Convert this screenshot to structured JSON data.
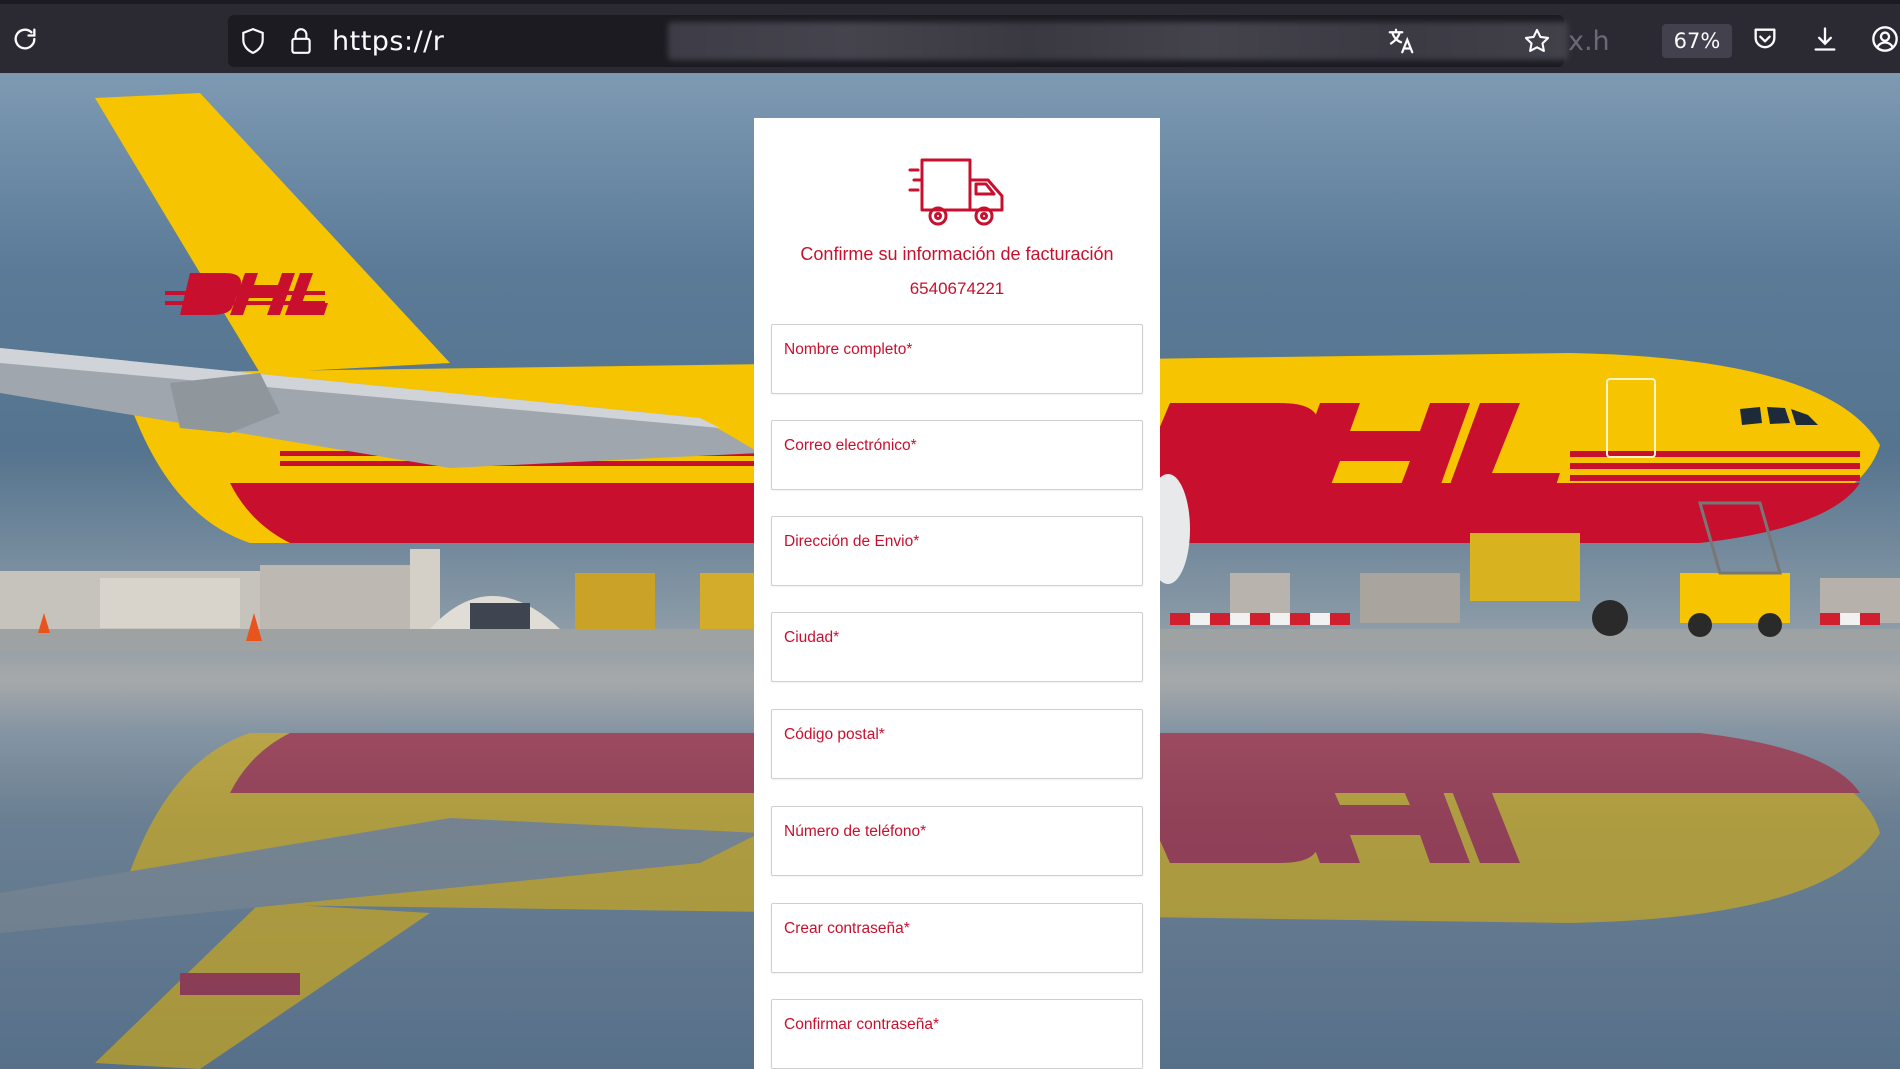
{
  "browser": {
    "url_prefix": "https://r",
    "url_suffix": "x.h",
    "zoom": "67%"
  },
  "form": {
    "title": "Confirme su información de facturación",
    "tracking_number": "6540674221",
    "fields": [
      {
        "label": "Nombre completo*"
      },
      {
        "label": "Correo electrónico*"
      },
      {
        "label": "Dirección de Envio*"
      },
      {
        "label": "Ciudad*"
      },
      {
        "label": "Código postal*"
      },
      {
        "label": "Número de teléfono*"
      },
      {
        "label": "Crear contraseña*"
      },
      {
        "label": "Confirmar contraseña*"
      }
    ]
  },
  "branding": {
    "logo": "DHL",
    "colors": {
      "yellow": "#f6c400",
      "red": "#c8102e"
    }
  },
  "icons": [
    "reload-icon",
    "shield-icon",
    "lock-icon",
    "translate-icon",
    "star-icon",
    "pocket-icon",
    "download-icon",
    "account-icon",
    "truck-icon"
  ]
}
